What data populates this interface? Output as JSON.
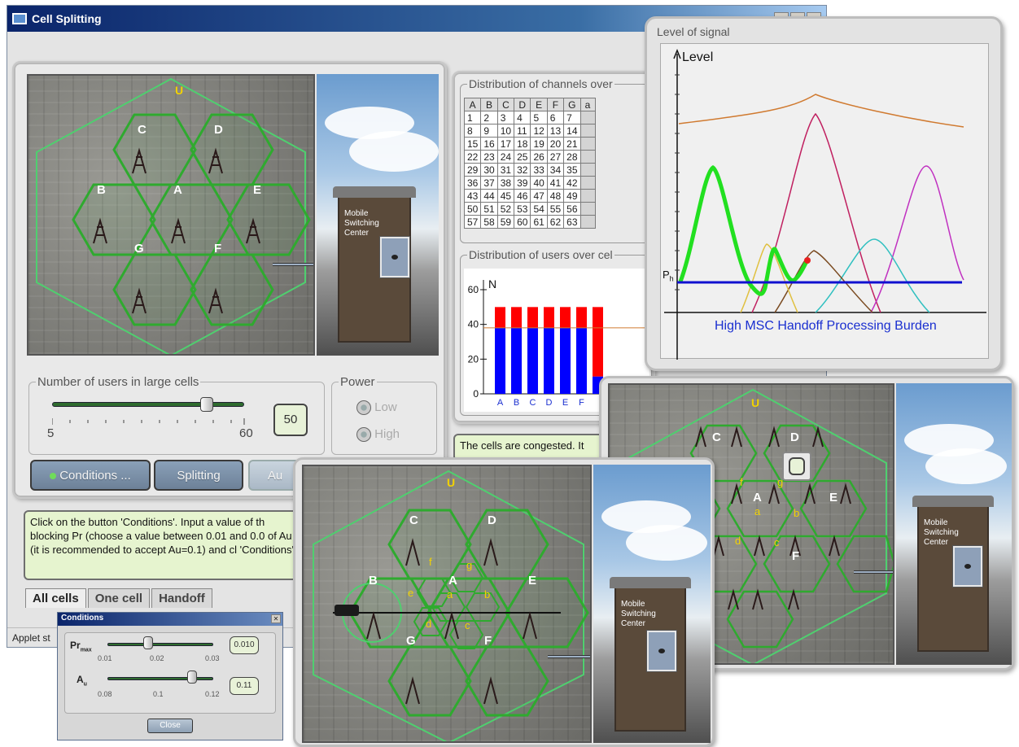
{
  "window": {
    "title": "Cell Splitting",
    "status": "Applet st"
  },
  "hexmap_main": {
    "top_label": "U",
    "cells": [
      "C",
      "D",
      "B",
      "A",
      "E",
      "G",
      "F"
    ]
  },
  "msc": {
    "sign": "Mobile Switching Center",
    "line1": "Mobile",
    "line2": "Switching",
    "line3": "Center"
  },
  "channels": {
    "title": "Distribution of channels over",
    "headers": [
      "A",
      "B",
      "C",
      "D",
      "E",
      "F",
      "G",
      "a"
    ],
    "rows": [
      [
        "1",
        "2",
        "3",
        "4",
        "5",
        "6",
        "7"
      ],
      [
        "8",
        "9",
        "10",
        "11",
        "12",
        "13",
        "14"
      ],
      [
        "15",
        "16",
        "17",
        "18",
        "19",
        "20",
        "21"
      ],
      [
        "22",
        "23",
        "24",
        "25",
        "26",
        "27",
        "28"
      ],
      [
        "29",
        "30",
        "31",
        "32",
        "33",
        "34",
        "35"
      ],
      [
        "36",
        "37",
        "38",
        "39",
        "40",
        "41",
        "42"
      ],
      [
        "43",
        "44",
        "45",
        "46",
        "47",
        "48",
        "49"
      ],
      [
        "50",
        "51",
        "52",
        "53",
        "54",
        "55",
        "56"
      ],
      [
        "57",
        "58",
        "59",
        "60",
        "61",
        "62",
        "63"
      ]
    ]
  },
  "users_chart": {
    "title": "Distribution of users over cel",
    "ylabel": "N",
    "chart_data": {
      "type": "bar",
      "categories": [
        "A",
        "B",
        "C",
        "D",
        "E",
        "F",
        ""
      ],
      "series": [
        {
          "values": [
            38,
            38,
            38,
            38,
            38,
            38,
            10
          ],
          "color": "#0000ff"
        },
        {
          "values": [
            12,
            12,
            12,
            12,
            12,
            12,
            40
          ],
          "color": "#ff0000"
        }
      ],
      "yticks": [
        "0",
        "20",
        "40",
        "60"
      ],
      "ylim": [
        0,
        60
      ],
      "threshold": 38
    }
  },
  "users_slider": {
    "title": "Number of users in large cells",
    "min_label": "5",
    "max_label": "60",
    "value": "50",
    "fraction": 0.82
  },
  "power": {
    "title": "Power",
    "low": "Low",
    "high": "High"
  },
  "buttons": {
    "conditions": "Conditions ...",
    "splitting": "Splitting",
    "auto": "Au"
  },
  "info_main": "Click on the button 'Conditions'. Input a value of th blocking Pr (choose a value between 0.01 and 0.0 of Au (it is recommended to accept Au=0.1) and cl 'Conditions'.",
  "info_second": "The cells are congested. It",
  "tabs": [
    "All cells",
    "One cell",
    "Handoff"
  ],
  "conditions_dialog": {
    "title": "Conditions",
    "pr_label": "Pr",
    "pr_sub": "max",
    "pr_ticks": [
      "0.01",
      "0.02",
      "0.03"
    ],
    "pr_value": "0.010",
    "au_label": "A",
    "au_sub": "u",
    "au_ticks": [
      "0.08",
      "0.1",
      "0.12"
    ],
    "au_value": "0.11",
    "close": "Close"
  },
  "signal": {
    "title": "Level of signal",
    "ylabel": "Level",
    "threshold_label": "P",
    "threshold_sub": "h",
    "caption": "High MSC Handoff Processing Burden"
  },
  "hexmap_small": {
    "top_label": "U",
    "cells": [
      "C",
      "D",
      "B",
      "A",
      "E",
      "G",
      "F"
    ],
    "sub_cells": [
      "f",
      "g",
      "e",
      "a",
      "b",
      "d",
      "c"
    ]
  },
  "hexmap_right": {
    "top_label": "U",
    "cells": [
      "C",
      "D",
      "A",
      "E",
      "F"
    ],
    "sub_cells": [
      "f",
      "g",
      "a",
      "b",
      "d",
      "c"
    ]
  }
}
